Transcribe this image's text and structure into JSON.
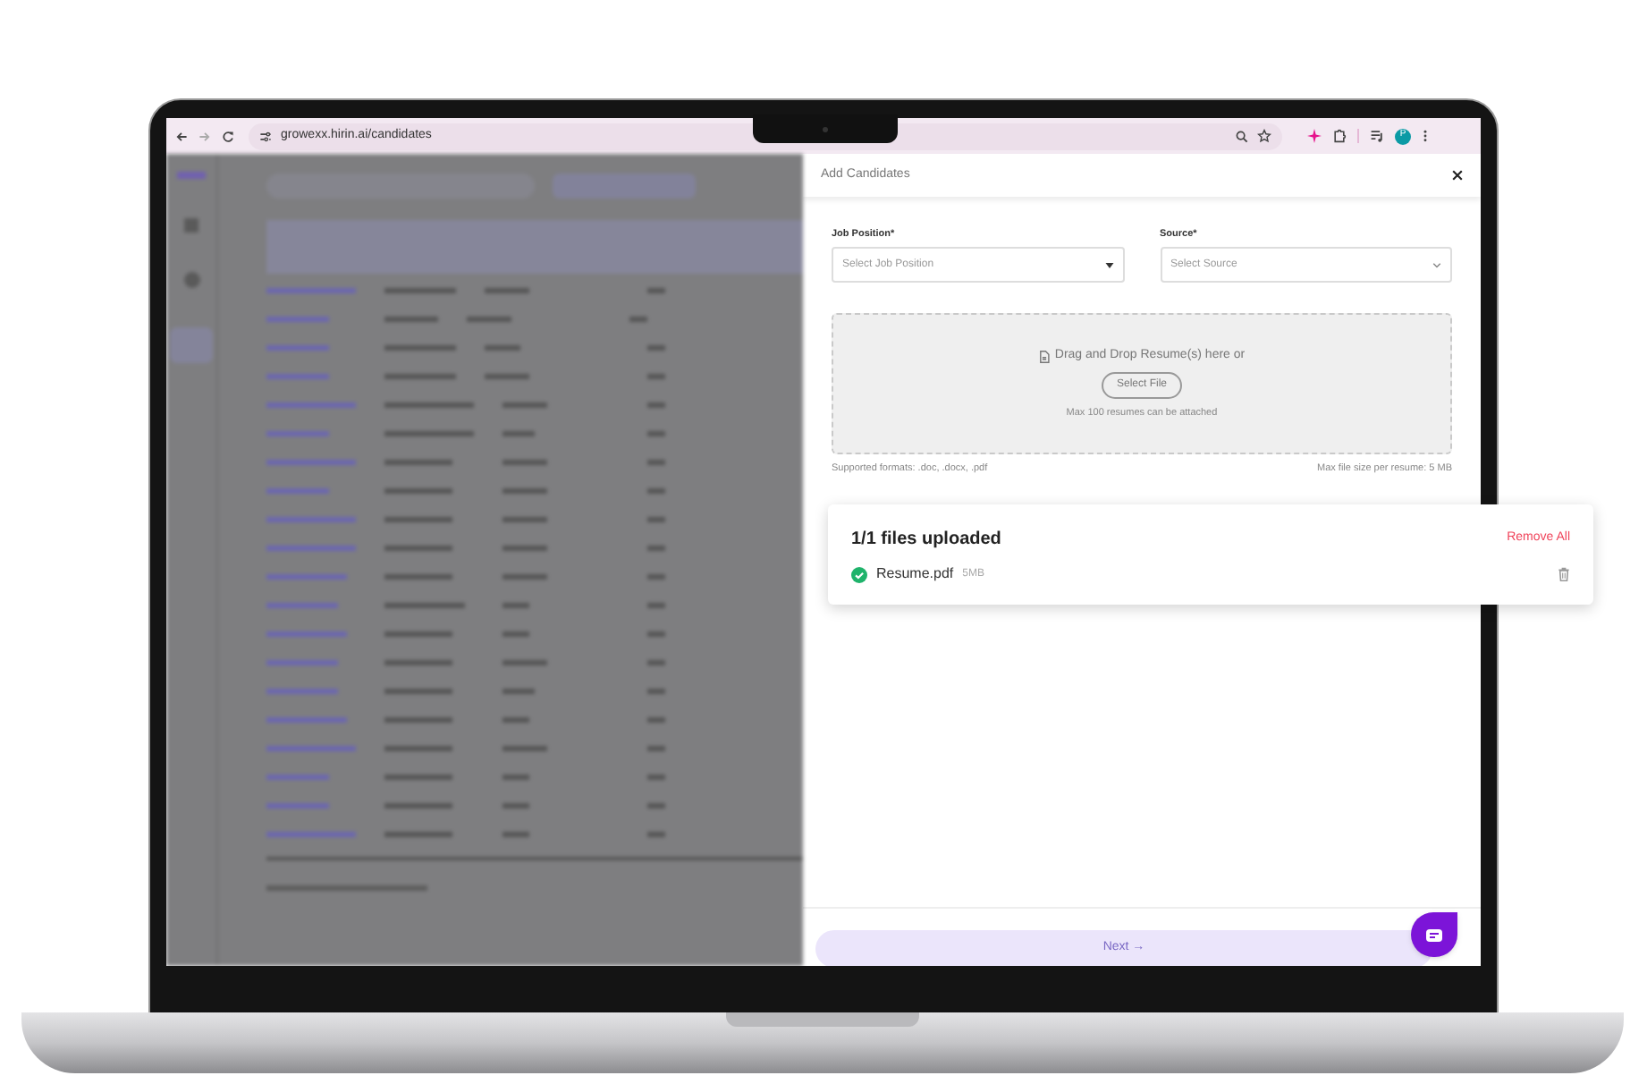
{
  "browser": {
    "url": "growexx.hirin.ai/candidates",
    "profile_initial": "P"
  },
  "panel": {
    "title": "Add Candidates",
    "fields": [
      {
        "label": "Job Position*",
        "placeholder": "Select Job Position",
        "kind": "triangle"
      },
      {
        "label": "Source*",
        "placeholder": "Select Source",
        "kind": "chevron"
      }
    ],
    "dropzone": {
      "prompt": "Drag and Drop Resume(s) here or",
      "button": "Select File",
      "note": "Max 100 resumes can be attached"
    },
    "formats_note": "Supported formats: .doc, .docx, .pdf",
    "size_note": "Max file size per resume: 5 MB",
    "uploads": {
      "title": "1/1 files uploaded",
      "remove_all": "Remove All",
      "files": [
        {
          "name": "Resume.pdf",
          "size": "5MB",
          "uploaded": true
        }
      ]
    },
    "next_button": {
      "label": "Next →",
      "disabled": true
    }
  }
}
